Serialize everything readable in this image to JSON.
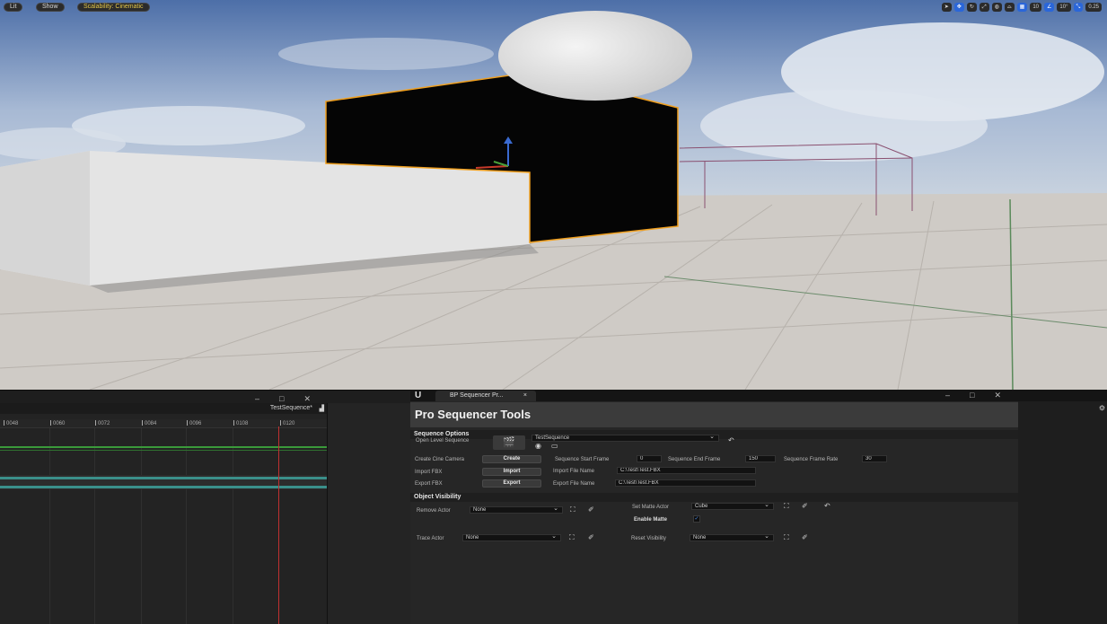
{
  "viewport": {
    "lit_label": "Lit",
    "show_label": "Show",
    "scalability_label": "Scalability: Cinematic",
    "toolbar": {
      "grid_snap": "10",
      "rotation_snap": "10°",
      "scale_snap": "0.25"
    }
  },
  "sequencer": {
    "sequence_name": "TestSequence*",
    "ruler_ticks": [
      "0048",
      "0060",
      "0072",
      "0084",
      "0096",
      "0108",
      "0120"
    ]
  },
  "panel": {
    "tab_label": "BP Sequencer Pr...",
    "title": "Pro Sequencer Tools",
    "sequence_options": {
      "header": "Sequence Options",
      "open_level_sequence_label": "Open Level Sequence",
      "sequence_value": "TestSequence",
      "create_cine_camera_label": "Create Cine Camera",
      "create_button": "Create",
      "start_frame_label": "Sequence Start Frame",
      "start_frame_value": "0",
      "end_frame_label": "Sequence End Frame",
      "end_frame_value": "150",
      "frame_rate_label": "Sequence Frame Rate",
      "frame_rate_value": "30",
      "import_fbx_label": "Import FBX",
      "import_button": "Import",
      "import_file_label": "Import File Name",
      "import_file_value": "C:\\Test\\Test.FBX",
      "export_fbx_label": "Export FBX",
      "export_button": "Export",
      "export_file_label": "Export File Name",
      "export_file_value": "C:\\Test\\Test.FBX"
    },
    "object_visibility": {
      "header": "Object Visibility",
      "remove_actor_label": "Remove Actor",
      "remove_actor_value": "None",
      "set_matte_actor_label": "Set Matte Actor",
      "set_matte_actor_value": "Cube",
      "enable_matte_label": "Enable Matte",
      "trace_actor_label": "Trace Actor",
      "trace_actor_value": "None",
      "reset_visibility_label": "Reset Visibility",
      "reset_visibility_value": "None"
    }
  }
}
